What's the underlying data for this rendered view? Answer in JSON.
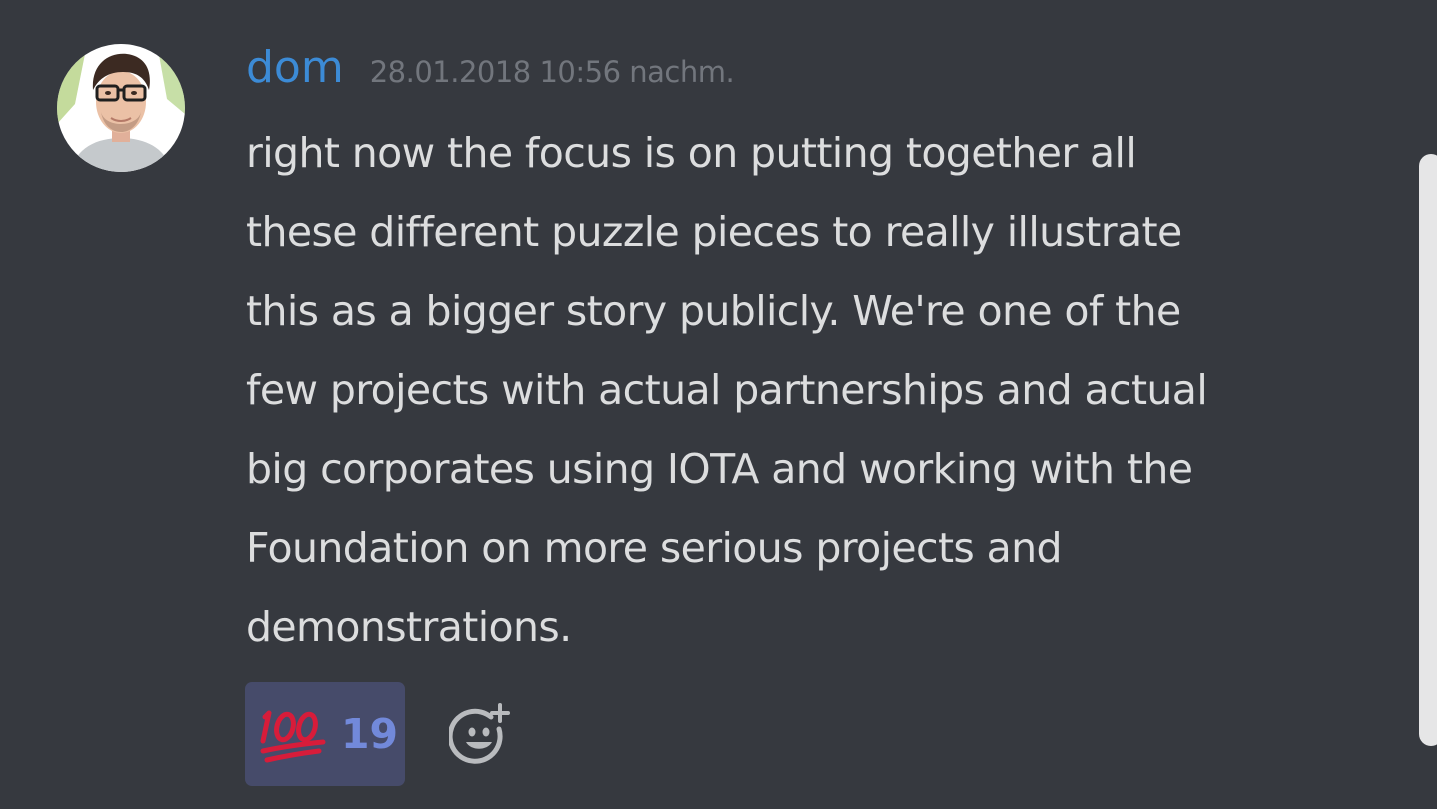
{
  "message": {
    "author": "dom",
    "timestamp": "28.01.2018 10:56 nachm.",
    "lines": [
      "right now the focus is on putting together all",
      "these different puzzle pieces to really illustrate",
      "this as a bigger story publicly. We're one of the",
      "few projects with actual partnerships and actual",
      "big corporates using IOTA and working with the",
      "Foundation on more serious projects and",
      "demonstrations."
    ],
    "avatar_icon": "avatar-photo-icon"
  },
  "reactions": [
    {
      "emoji": "hundred-points-emoji",
      "count": "19"
    }
  ],
  "add_reaction_icon": "add-reaction-icon",
  "colors": {
    "background": "#36393f",
    "username": "#3c8bd6",
    "timestamp": "#72767d",
    "text": "#dcddde",
    "reaction_bg": "#464b6a",
    "reaction_count": "#7289da",
    "hundred_red": "#d71c3a",
    "scrollbar": "#e6e6e7"
  }
}
